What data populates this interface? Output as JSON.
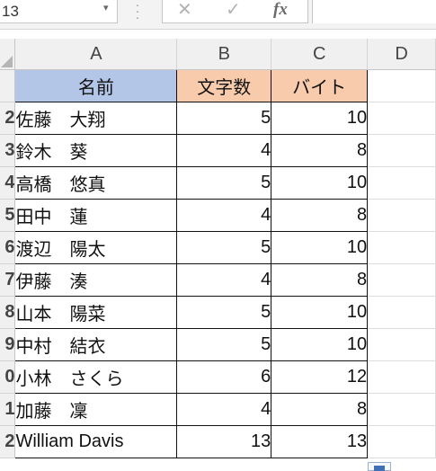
{
  "formula_bar": {
    "name_box": "13",
    "cancel_icon": "✕",
    "enter_icon": "✓",
    "fx_label": "fx"
  },
  "columns": [
    "A",
    "B",
    "C",
    "D"
  ],
  "row_numbers": [
    "",
    "2",
    "3",
    "4",
    "5",
    "6",
    "7",
    "8",
    "9",
    "0",
    "1",
    "2"
  ],
  "header_row": {
    "a": "名前",
    "b": "文字数",
    "c": "バイト"
  },
  "colors": {
    "header_a": "#b4c6e7",
    "header_bc": "#f8cbad"
  },
  "rows": [
    {
      "row": "2",
      "name": "佐藤　大翔",
      "chars": "5",
      "bytes": "10"
    },
    {
      "row": "3",
      "name": "鈴木　葵",
      "chars": "4",
      "bytes": "8"
    },
    {
      "row": "4",
      "name": "高橋　悠真",
      "chars": "5",
      "bytes": "10"
    },
    {
      "row": "5",
      "name": "田中　蓮",
      "chars": "4",
      "bytes": "8"
    },
    {
      "row": "6",
      "name": "渡辺　陽太",
      "chars": "5",
      "bytes": "10"
    },
    {
      "row": "7",
      "name": "伊藤　湊",
      "chars": "4",
      "bytes": "8"
    },
    {
      "row": "8",
      "name": "山本　陽菜",
      "chars": "5",
      "bytes": "10"
    },
    {
      "row": "9",
      "name": "中村　結衣",
      "chars": "5",
      "bytes": "10"
    },
    {
      "row": "0",
      "name": "小林　さくら",
      "chars": "6",
      "bytes": "12"
    },
    {
      "row": "1",
      "name": "加藤　凜",
      "chars": "4",
      "bytes": "8"
    },
    {
      "row": "2",
      "name": "William Davis",
      "chars": "13",
      "bytes": "13"
    }
  ]
}
